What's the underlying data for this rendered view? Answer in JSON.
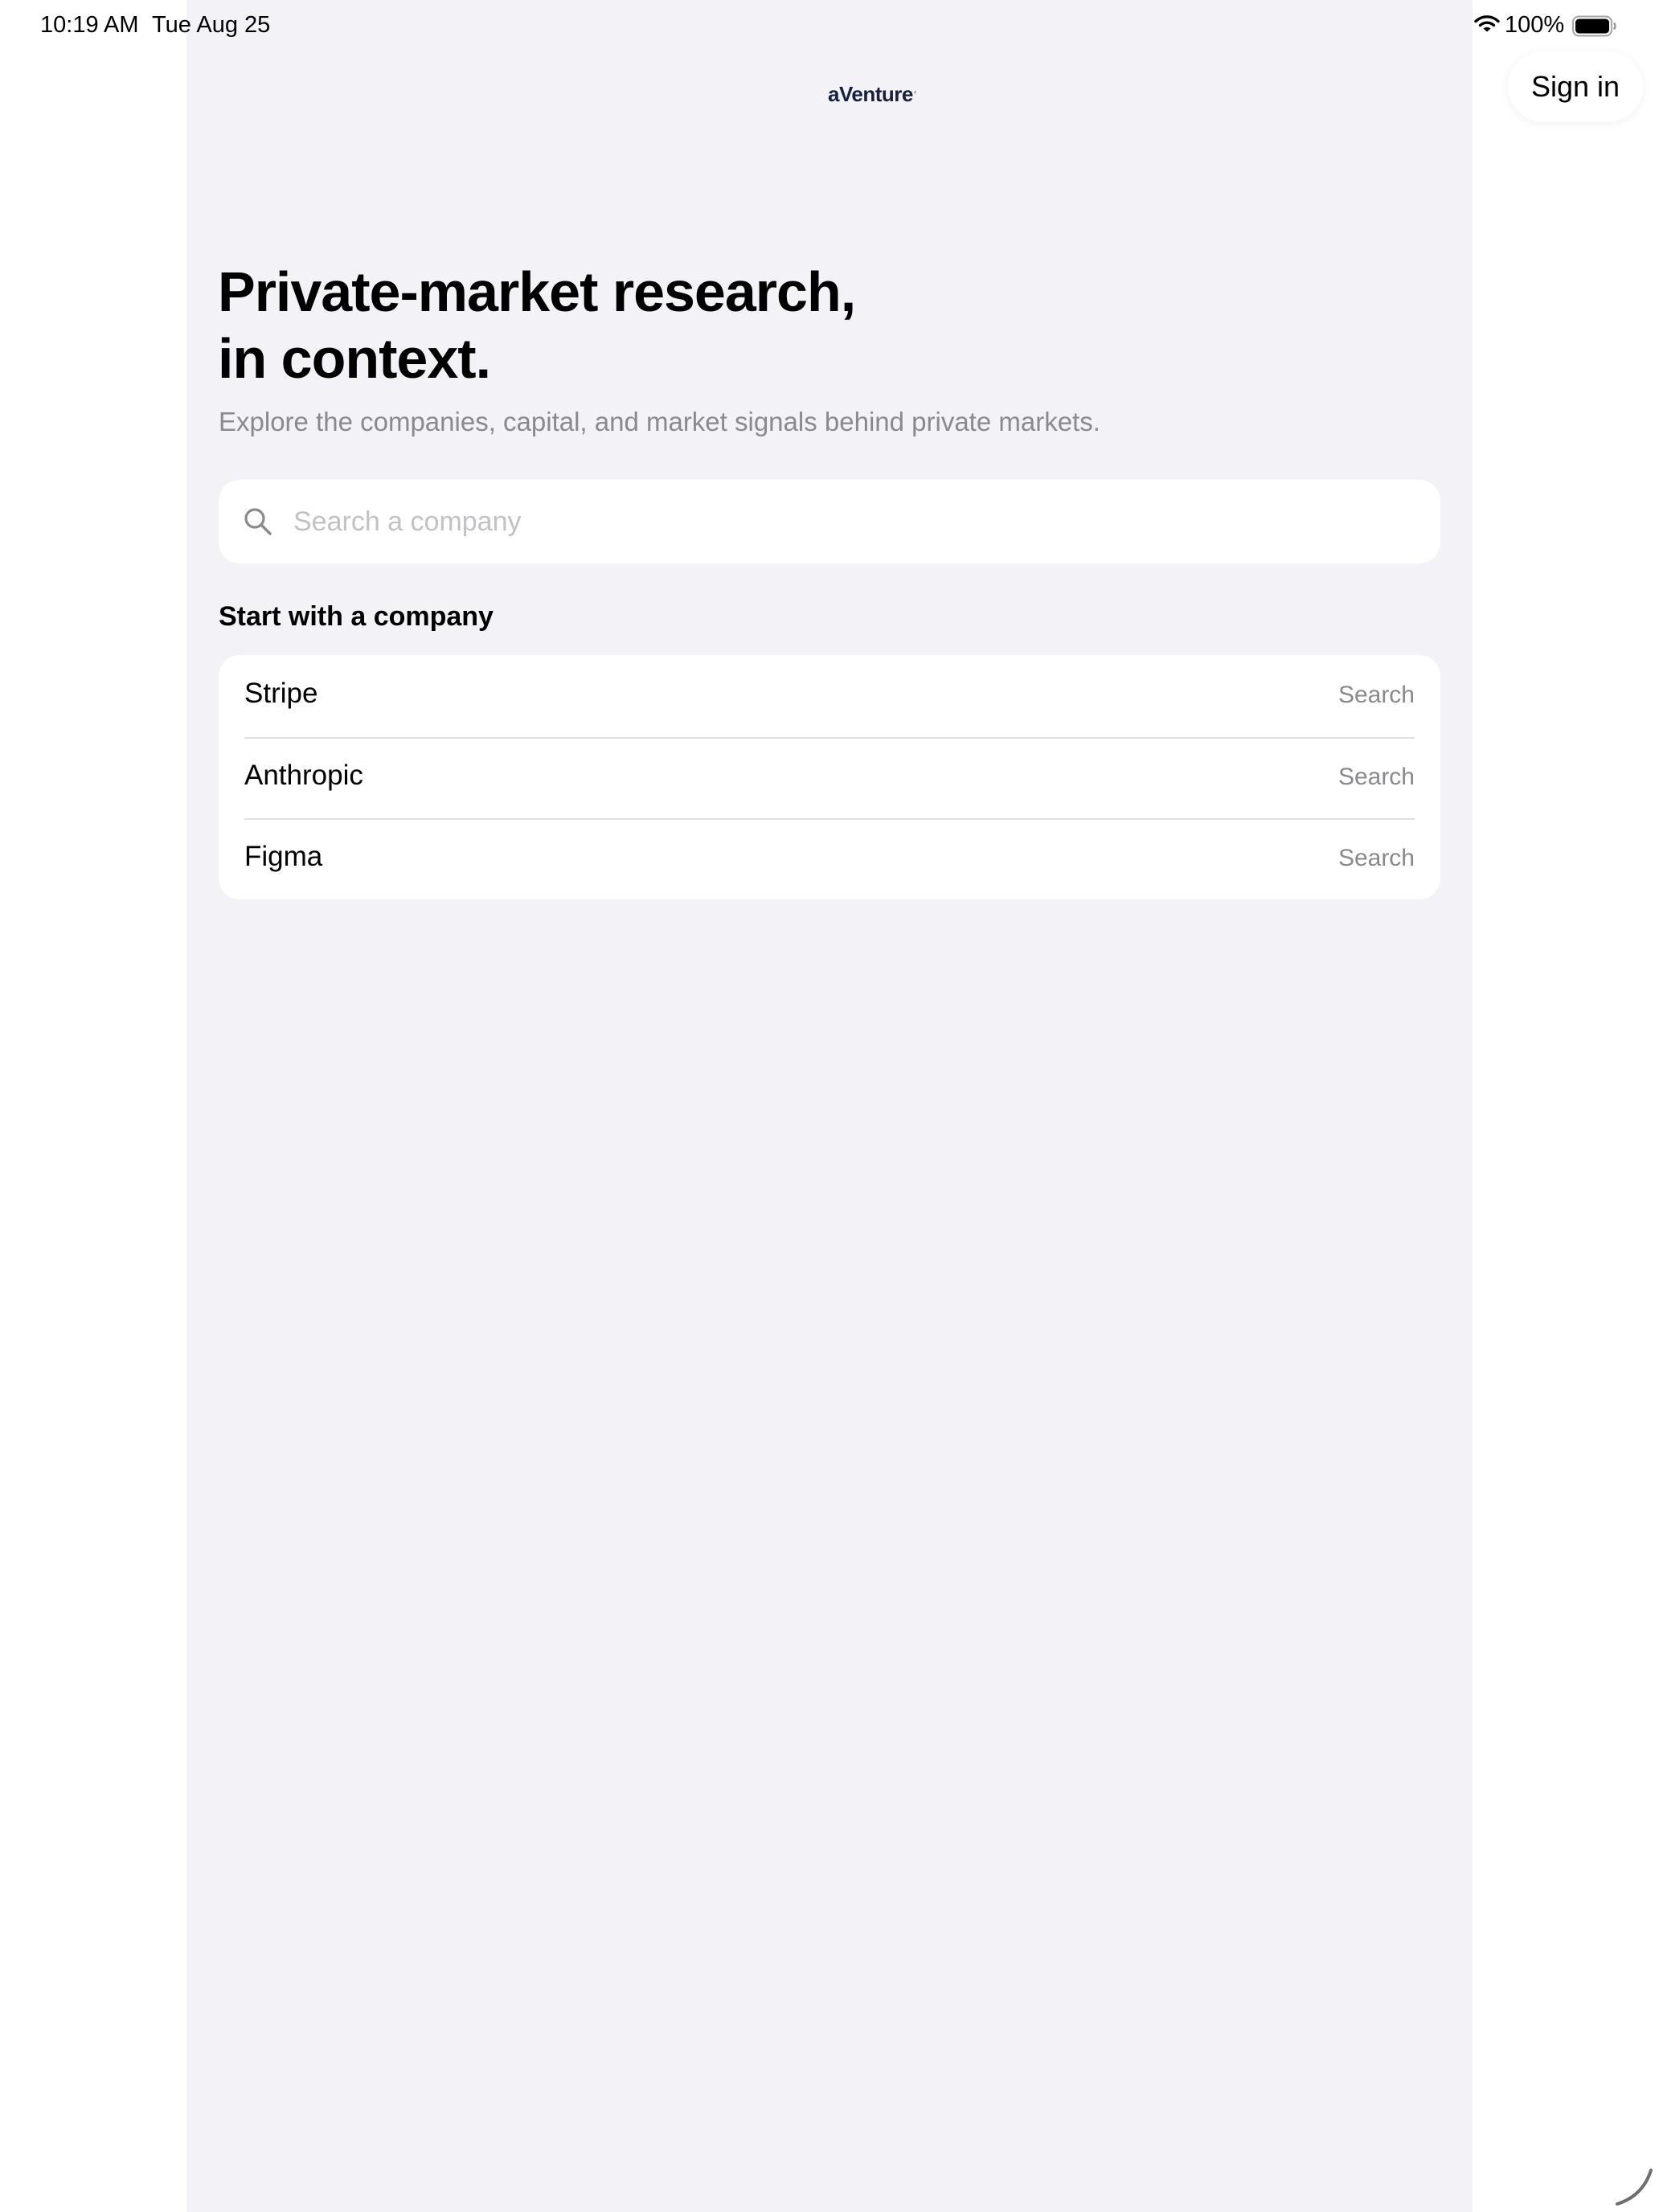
{
  "status_bar": {
    "time": "10:19 AM",
    "date": "Tue Aug 25",
    "battery_percent": "100%",
    "icons": [
      "wifi-icon",
      "battery-icon"
    ]
  },
  "header": {
    "logo_text": "aVenture",
    "sign_in_label": "Sign in"
  },
  "hero": {
    "title_line1": "Private-market research,",
    "title_line2": "in context.",
    "subtitle": "Explore the companies, capital, and market signals behind private markets."
  },
  "search": {
    "placeholder": "Search a company",
    "value": "",
    "icon": "search-icon"
  },
  "suggestions": {
    "heading": "Start with a company",
    "items": [
      {
        "name": "Stripe",
        "action": "Search"
      },
      {
        "name": "Anthropic",
        "action": "Search"
      },
      {
        "name": "Figma",
        "action": "Search"
      }
    ]
  },
  "colors": {
    "page_background": "#f2f2f7",
    "card_background": "#ffffff",
    "secondary_text": "#8a8a8e",
    "placeholder_text": "#c2c2c6",
    "logo": "#16213e"
  }
}
